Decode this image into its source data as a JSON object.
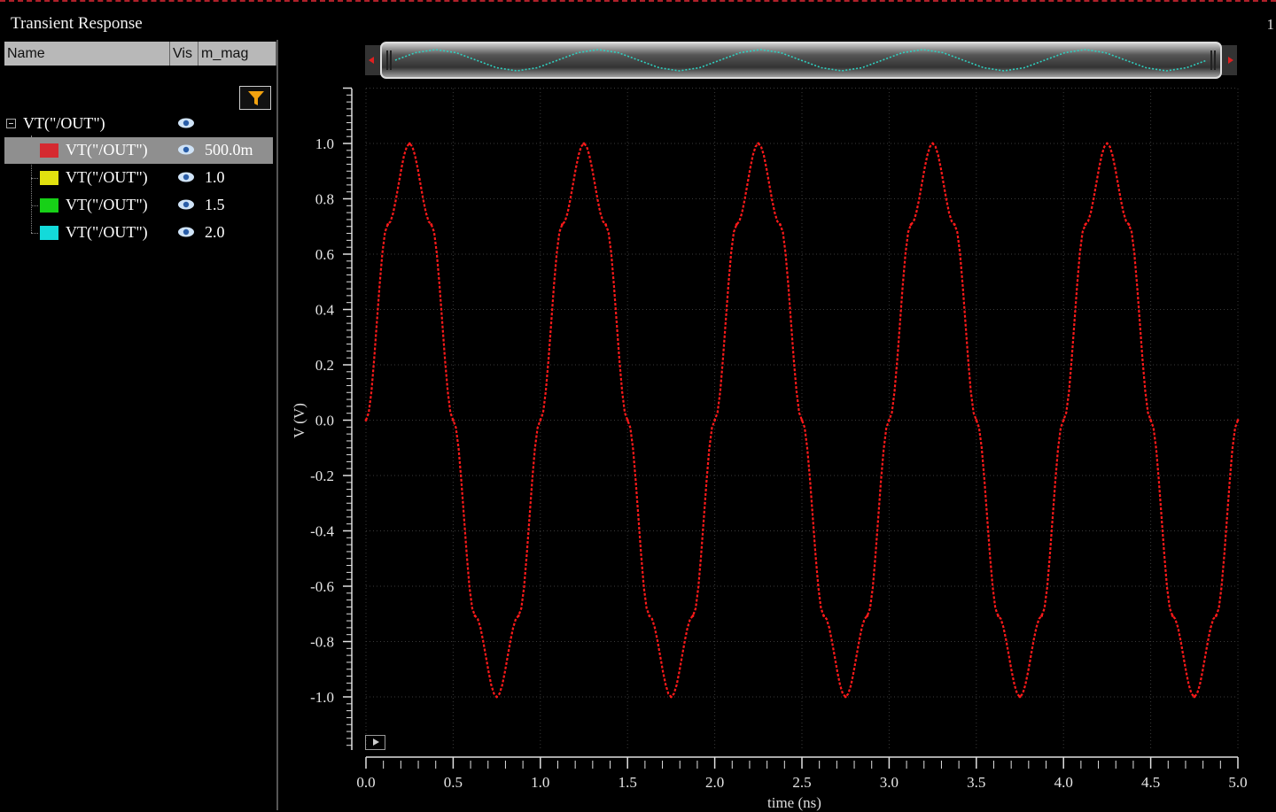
{
  "window": {
    "title": "Transient Response",
    "corner_label": "1"
  },
  "signal_table": {
    "columns": [
      "Name",
      "Vis",
      "m_mag"
    ],
    "parent": {
      "name": "VT(\"/OUT\")",
      "icon": "eye-icon"
    },
    "rows": [
      {
        "color": "#d52a30",
        "name": "VT(\"/OUT\")",
        "value": "500.0m",
        "selected": true
      },
      {
        "color": "#e1e10f",
        "name": "VT(\"/OUT\")",
        "value": "1.0",
        "selected": false
      },
      {
        "color": "#17d117",
        "name": "VT(\"/OUT\")",
        "value": "1.5",
        "selected": false
      },
      {
        "color": "#13dada",
        "name": "VT(\"/OUT\")",
        "value": "2.0",
        "selected": false
      }
    ],
    "filter_icon": "funnel-icon"
  },
  "colors": {
    "trace": "#ff1a1a",
    "overview_trace": "#2fd0c0",
    "grid": "#3a3a3a",
    "axis": "#e0e0e0"
  },
  "chart_data": {
    "type": "line",
    "xlabel": "time (ns)",
    "ylabel": "V (V)",
    "xlim": [
      0,
      5
    ],
    "ylim": [
      -1.2,
      1.2
    ],
    "x_ticks": [
      "0.0",
      "0.5",
      "1.0",
      "1.5",
      "2.0",
      "2.5",
      "3.0",
      "3.5",
      "4.0",
      "4.5",
      "5.0"
    ],
    "y_ticks": [
      "1.0",
      "0.8",
      "0.6",
      "0.4",
      "0.2",
      "0.0",
      "-0.2",
      "-0.4",
      "-0.6",
      "-0.8",
      "-1.0"
    ],
    "series": [
      {
        "name": "VT(\"/OUT\")",
        "color": "#ff1a1a",
        "dashed": true,
        "x": [
          0.0,
          0.125,
          0.25,
          0.375,
          0.5,
          0.625,
          0.75,
          0.875,
          1.0,
          1.125,
          1.25,
          1.375,
          1.5,
          1.625,
          1.75,
          1.875,
          2.0,
          2.125,
          2.25,
          2.375,
          2.5,
          2.625,
          2.75,
          2.875,
          3.0,
          3.125,
          3.25,
          3.375,
          3.5,
          3.625,
          3.75,
          3.875,
          4.0,
          4.125,
          4.25,
          4.375,
          4.5,
          4.625,
          4.75,
          4.875,
          5.0
        ],
        "y": [
          0.0,
          0.707,
          1.0,
          0.707,
          0.0,
          -0.707,
          -1.0,
          -0.707,
          0.0,
          0.707,
          1.0,
          0.707,
          0.0,
          -0.707,
          -1.0,
          -0.707,
          0.0,
          0.707,
          1.0,
          0.707,
          0.0,
          -0.707,
          -1.0,
          -0.707,
          0.0,
          0.707,
          1.0,
          0.707,
          0.0,
          -0.707,
          -1.0,
          -0.707,
          0.0,
          0.707,
          1.0,
          0.707,
          0.0,
          -0.707,
          -1.0,
          -0.707,
          0.0
        ]
      }
    ]
  }
}
